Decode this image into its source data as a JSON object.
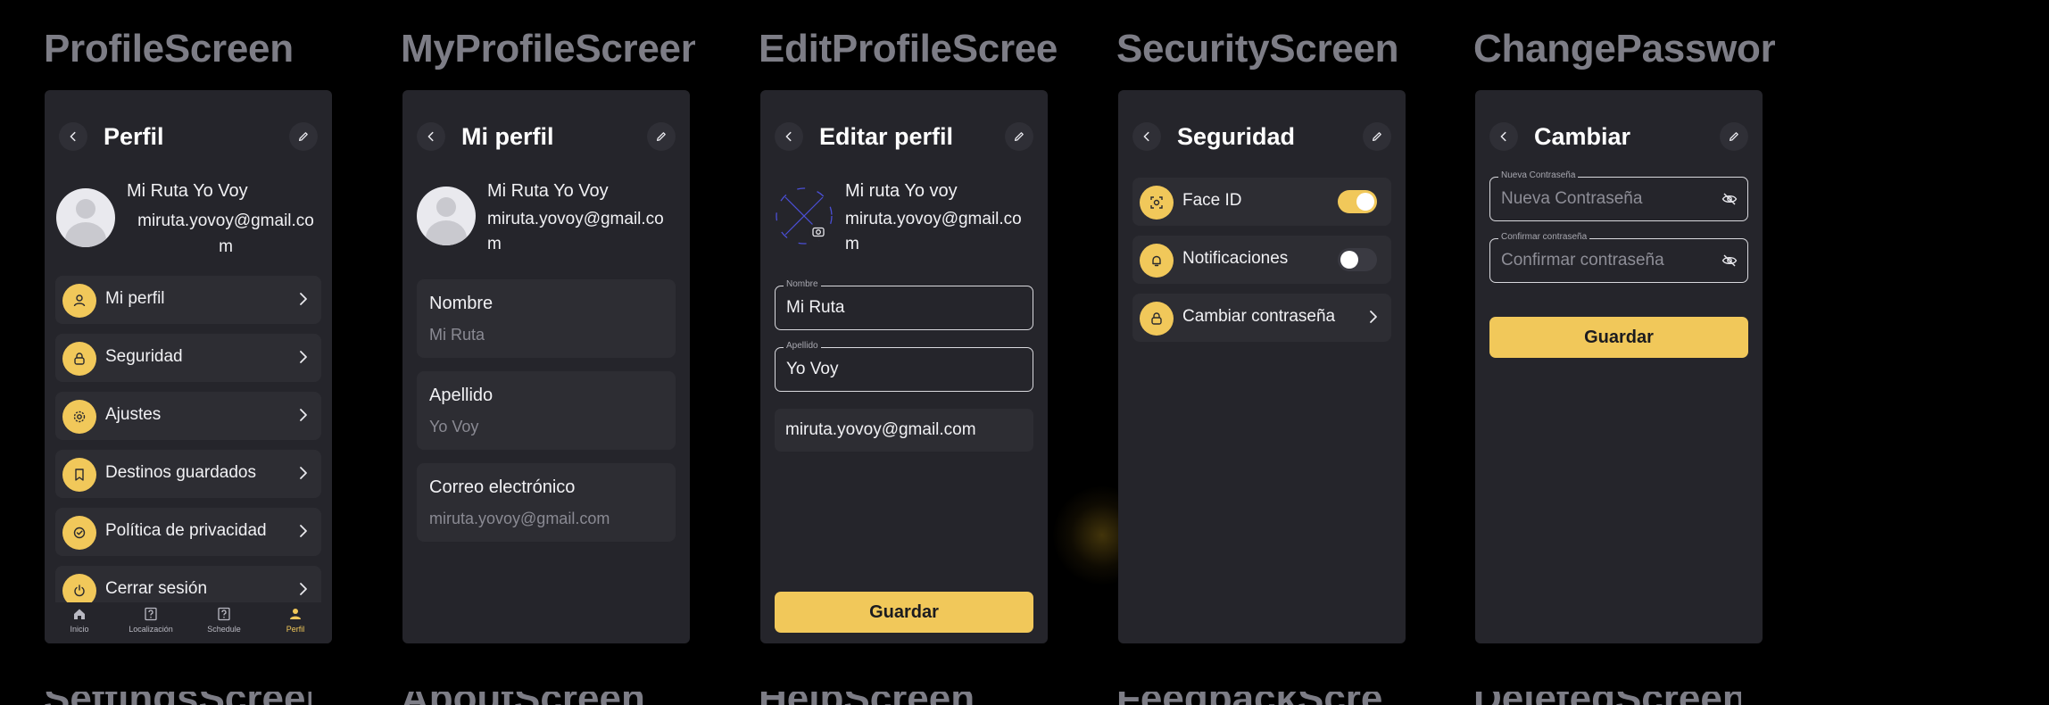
{
  "columns": [
    "ProfileScreen",
    "MyProfileScreen",
    "EditProfileScreen",
    "SecurityScreen",
    "ChangePasswordScreen"
  ],
  "row2_columns": [
    "SettingsScreen",
    "AboutScreen",
    "HelpScreen",
    "FeedbackScreen",
    "DeletedScreen"
  ],
  "profile": {
    "title": "Perfil",
    "name": "Mi Ruta Yo Voy",
    "email_line1": "miruta.yovoy@gmail.co",
    "email_line2": "m",
    "menu": [
      {
        "label": "Mi perfil",
        "icon": "user-icon"
      },
      {
        "label": "Seguridad",
        "icon": "lock-icon"
      },
      {
        "label": "Ajustes",
        "icon": "gear-icon"
      },
      {
        "label": "Destinos guardados",
        "icon": "bookmark-icon"
      },
      {
        "label": "Política de privacidad",
        "icon": "shield-icon"
      },
      {
        "label": "Cerrar sesión",
        "icon": "power-icon"
      }
    ],
    "tabs": [
      {
        "label": "Inicio",
        "icon": "home-icon"
      },
      {
        "label": "Localización",
        "icon": "help-box-icon"
      },
      {
        "label": "Schedule",
        "icon": "help-box-icon"
      },
      {
        "label": "Perfil",
        "icon": "person-icon"
      }
    ]
  },
  "my_profile": {
    "title": "Mi perfil",
    "name": "Mi Ruta Yo Voy",
    "email_line1": "miruta.yovoy@gmail.co",
    "email_line2": "m",
    "fields": [
      {
        "label": "Nombre",
        "value": "Mi Ruta"
      },
      {
        "label": "Apellido",
        "value": "Yo Voy"
      },
      {
        "label": "Correo electrónico",
        "value": "miruta.yovoy@gmail.com"
      }
    ]
  },
  "edit_profile": {
    "title": "Editar perfil",
    "name": "Mi ruta Yo voy",
    "email_line1": "miruta.yovoy@gmail.co",
    "email_line2": "m",
    "first_name_label": "Nombre",
    "first_name_value": "Mi Ruta",
    "last_name_label": "Apellido",
    "last_name_value": "Yo Voy",
    "email_value": "miruta.yovoy@gmail.com",
    "save_label": "Guardar"
  },
  "security": {
    "title": "Seguridad",
    "items": [
      {
        "label": "Face ID",
        "icon": "face-id-icon",
        "toggle": "on"
      },
      {
        "label": "Notificaciones",
        "icon": "bell-icon",
        "toggle": "off"
      },
      {
        "label": "Cambiar contraseña",
        "icon": "lock-icon",
        "toggle": null
      }
    ]
  },
  "change_password": {
    "title": "Cambiar",
    "new_label": "Nueva Contraseña",
    "new_placeholder": "Nueva Contraseña",
    "confirm_label": "Confirmar contraseña",
    "confirm_placeholder": "Confirmar contraseña",
    "save_label": "Guardar"
  },
  "colors": {
    "accent": "#f1c85a",
    "panel": "#25252b",
    "card": "#2d2d33",
    "background": "#000000"
  }
}
